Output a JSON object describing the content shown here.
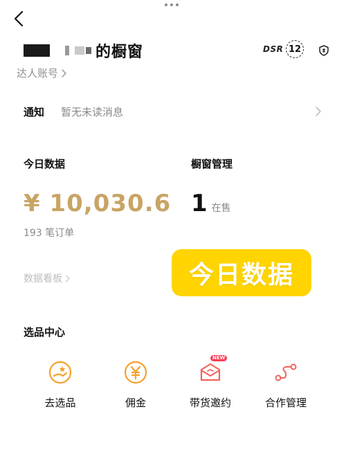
{
  "header": {
    "shop_title": "的橱窗",
    "account_type": "达人账号",
    "dsr_label": "DSR",
    "level": "12"
  },
  "notice": {
    "label": "通知",
    "text": "暂无未读消息"
  },
  "today_data": {
    "title": "今日数据",
    "amount": "¥ 10,030.6",
    "orders": "193 笔订单",
    "board_link": "数据看板"
  },
  "window_management": {
    "title": "橱窗管理",
    "on_sale_count": "1",
    "on_sale_label": "在售"
  },
  "overlay_banner": {
    "text": "今日数据"
  },
  "select_center": {
    "title": "选品中心",
    "items": [
      {
        "label": "去选品",
        "icon": "selection-icon"
      },
      {
        "label": "佣金",
        "icon": "yen-icon"
      },
      {
        "label": "带货邀约",
        "icon": "envelope-icon",
        "badge": "NEW"
      },
      {
        "label": "合作管理",
        "icon": "route-icon"
      }
    ]
  },
  "colors": {
    "accent_orange": "#f5a02a",
    "accent_red": "#f0645a",
    "amount_gold": "#c8a464",
    "banner_yellow": "#ffd400"
  }
}
